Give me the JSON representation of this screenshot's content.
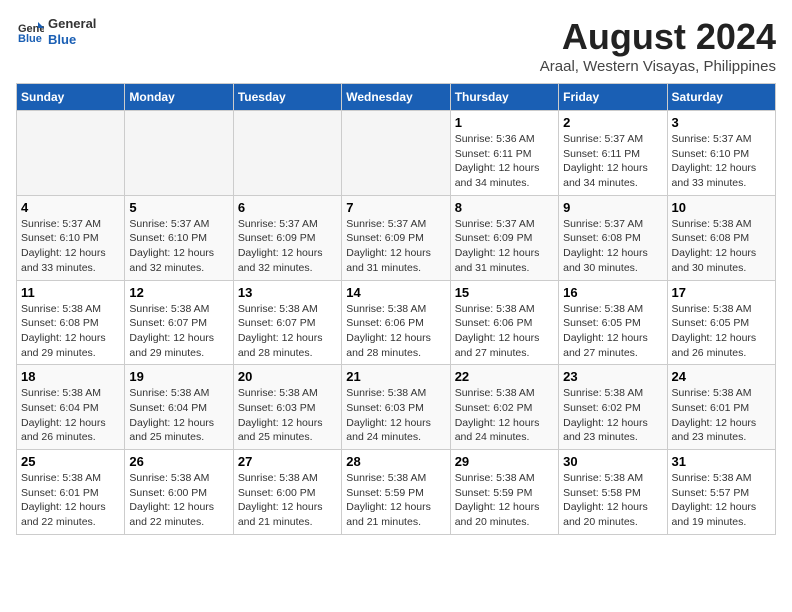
{
  "header": {
    "logo_general": "General",
    "logo_blue": "Blue",
    "main_title": "August 2024",
    "subtitle": "Araal, Western Visayas, Philippines"
  },
  "weekdays": [
    "Sunday",
    "Monday",
    "Tuesday",
    "Wednesday",
    "Thursday",
    "Friday",
    "Saturday"
  ],
  "weeks": [
    [
      {
        "day": "",
        "info": ""
      },
      {
        "day": "",
        "info": ""
      },
      {
        "day": "",
        "info": ""
      },
      {
        "day": "",
        "info": ""
      },
      {
        "day": "1",
        "info": "Sunrise: 5:36 AM\nSunset: 6:11 PM\nDaylight: 12 hours\nand 34 minutes."
      },
      {
        "day": "2",
        "info": "Sunrise: 5:37 AM\nSunset: 6:11 PM\nDaylight: 12 hours\nand 34 minutes."
      },
      {
        "day": "3",
        "info": "Sunrise: 5:37 AM\nSunset: 6:10 PM\nDaylight: 12 hours\nand 33 minutes."
      }
    ],
    [
      {
        "day": "4",
        "info": "Sunrise: 5:37 AM\nSunset: 6:10 PM\nDaylight: 12 hours\nand 33 minutes."
      },
      {
        "day": "5",
        "info": "Sunrise: 5:37 AM\nSunset: 6:10 PM\nDaylight: 12 hours\nand 32 minutes."
      },
      {
        "day": "6",
        "info": "Sunrise: 5:37 AM\nSunset: 6:09 PM\nDaylight: 12 hours\nand 32 minutes."
      },
      {
        "day": "7",
        "info": "Sunrise: 5:37 AM\nSunset: 6:09 PM\nDaylight: 12 hours\nand 31 minutes."
      },
      {
        "day": "8",
        "info": "Sunrise: 5:37 AM\nSunset: 6:09 PM\nDaylight: 12 hours\nand 31 minutes."
      },
      {
        "day": "9",
        "info": "Sunrise: 5:37 AM\nSunset: 6:08 PM\nDaylight: 12 hours\nand 30 minutes."
      },
      {
        "day": "10",
        "info": "Sunrise: 5:38 AM\nSunset: 6:08 PM\nDaylight: 12 hours\nand 30 minutes."
      }
    ],
    [
      {
        "day": "11",
        "info": "Sunrise: 5:38 AM\nSunset: 6:08 PM\nDaylight: 12 hours\nand 29 minutes."
      },
      {
        "day": "12",
        "info": "Sunrise: 5:38 AM\nSunset: 6:07 PM\nDaylight: 12 hours\nand 29 minutes."
      },
      {
        "day": "13",
        "info": "Sunrise: 5:38 AM\nSunset: 6:07 PM\nDaylight: 12 hours\nand 28 minutes."
      },
      {
        "day": "14",
        "info": "Sunrise: 5:38 AM\nSunset: 6:06 PM\nDaylight: 12 hours\nand 28 minutes."
      },
      {
        "day": "15",
        "info": "Sunrise: 5:38 AM\nSunset: 6:06 PM\nDaylight: 12 hours\nand 27 minutes."
      },
      {
        "day": "16",
        "info": "Sunrise: 5:38 AM\nSunset: 6:05 PM\nDaylight: 12 hours\nand 27 minutes."
      },
      {
        "day": "17",
        "info": "Sunrise: 5:38 AM\nSunset: 6:05 PM\nDaylight: 12 hours\nand 26 minutes."
      }
    ],
    [
      {
        "day": "18",
        "info": "Sunrise: 5:38 AM\nSunset: 6:04 PM\nDaylight: 12 hours\nand 26 minutes."
      },
      {
        "day": "19",
        "info": "Sunrise: 5:38 AM\nSunset: 6:04 PM\nDaylight: 12 hours\nand 25 minutes."
      },
      {
        "day": "20",
        "info": "Sunrise: 5:38 AM\nSunset: 6:03 PM\nDaylight: 12 hours\nand 25 minutes."
      },
      {
        "day": "21",
        "info": "Sunrise: 5:38 AM\nSunset: 6:03 PM\nDaylight: 12 hours\nand 24 minutes."
      },
      {
        "day": "22",
        "info": "Sunrise: 5:38 AM\nSunset: 6:02 PM\nDaylight: 12 hours\nand 24 minutes."
      },
      {
        "day": "23",
        "info": "Sunrise: 5:38 AM\nSunset: 6:02 PM\nDaylight: 12 hours\nand 23 minutes."
      },
      {
        "day": "24",
        "info": "Sunrise: 5:38 AM\nSunset: 6:01 PM\nDaylight: 12 hours\nand 23 minutes."
      }
    ],
    [
      {
        "day": "25",
        "info": "Sunrise: 5:38 AM\nSunset: 6:01 PM\nDaylight: 12 hours\nand 22 minutes."
      },
      {
        "day": "26",
        "info": "Sunrise: 5:38 AM\nSunset: 6:00 PM\nDaylight: 12 hours\nand 22 minutes."
      },
      {
        "day": "27",
        "info": "Sunrise: 5:38 AM\nSunset: 6:00 PM\nDaylight: 12 hours\nand 21 minutes."
      },
      {
        "day": "28",
        "info": "Sunrise: 5:38 AM\nSunset: 5:59 PM\nDaylight: 12 hours\nand 21 minutes."
      },
      {
        "day": "29",
        "info": "Sunrise: 5:38 AM\nSunset: 5:59 PM\nDaylight: 12 hours\nand 20 minutes."
      },
      {
        "day": "30",
        "info": "Sunrise: 5:38 AM\nSunset: 5:58 PM\nDaylight: 12 hours\nand 20 minutes."
      },
      {
        "day": "31",
        "info": "Sunrise: 5:38 AM\nSunset: 5:57 PM\nDaylight: 12 hours\nand 19 minutes."
      }
    ]
  ]
}
